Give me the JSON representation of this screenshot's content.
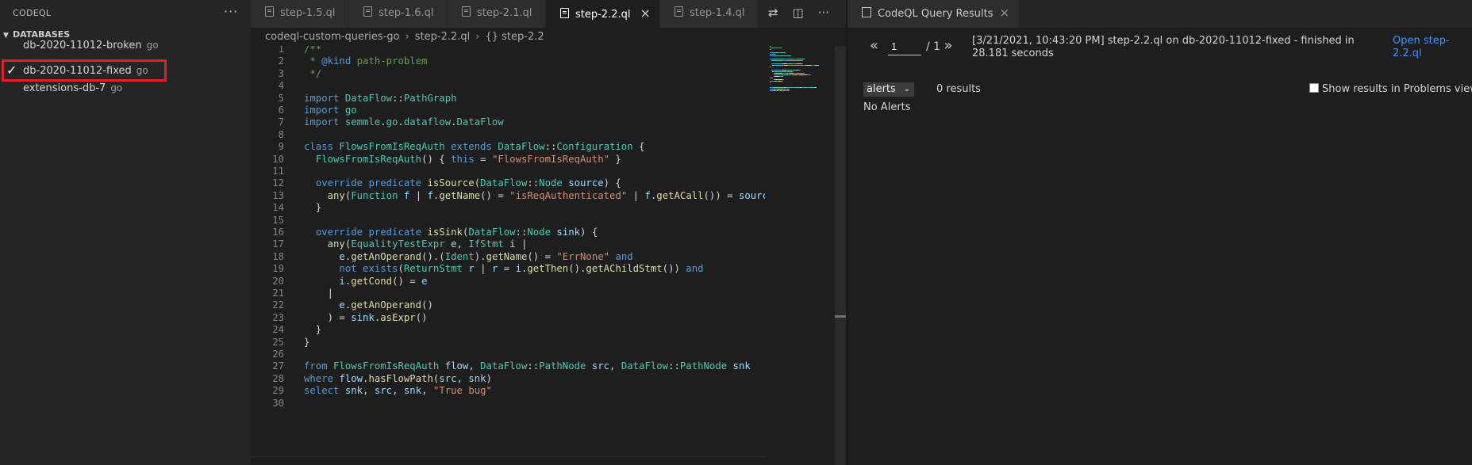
{
  "sidebar": {
    "title": "CODEQL",
    "more": "···",
    "section_label": "DATABASES",
    "items": [
      {
        "name": "db-2020-11012-broken",
        "lang": "go",
        "checked": false
      },
      {
        "name": "db-2020-11012-fixed",
        "lang": "go",
        "checked": true
      },
      {
        "name": "extensions-db-7",
        "lang": "go",
        "checked": false
      }
    ],
    "check_glyph": "✓"
  },
  "tabs": [
    {
      "label": "step-1.5.ql",
      "active": false
    },
    {
      "label": "step-1.6.ql",
      "active": false
    },
    {
      "label": "step-2.1.ql",
      "active": false
    },
    {
      "label": "step-2.2.ql",
      "active": true
    },
    {
      "label": "step-1.4.ql",
      "active": false
    }
  ],
  "tab_close": "×",
  "tab_actions": [
    "compare-changes-icon",
    "split-editor-icon",
    "more-actions-icon"
  ],
  "breadcrumb": [
    "codeql-custom-queries-go",
    "step-2.2.ql",
    "{} step-2.2"
  ],
  "code_lines": [
    [
      [
        "/**",
        "cmt"
      ]
    ],
    [
      [
        " * ",
        "cmt"
      ],
      [
        "@kind",
        "kw"
      ],
      [
        " path-problem",
        "cmt"
      ]
    ],
    [
      [
        " */",
        "cmt"
      ]
    ],
    [],
    [
      [
        "import ",
        "kw"
      ],
      [
        "DataFlow",
        "type"
      ],
      [
        "::",
        "plain"
      ],
      [
        "PathGraph",
        "type"
      ]
    ],
    [
      [
        "import ",
        "kw"
      ],
      [
        "go",
        "type"
      ]
    ],
    [
      [
        "import ",
        "kw"
      ],
      [
        "semmle",
        "type"
      ],
      [
        ".",
        "plain"
      ],
      [
        "go",
        "type"
      ],
      [
        ".",
        "plain"
      ],
      [
        "dataflow",
        "type"
      ],
      [
        ".",
        "plain"
      ],
      [
        "DataFlow",
        "type"
      ]
    ],
    [],
    [
      [
        "class ",
        "kw"
      ],
      [
        "FlowsFromIsReqAuth ",
        "type"
      ],
      [
        "extends ",
        "kw"
      ],
      [
        "DataFlow",
        "type"
      ],
      [
        "::",
        "plain"
      ],
      [
        "Configuration",
        "type"
      ],
      [
        " {",
        "plain"
      ]
    ],
    [
      [
        "  ",
        "plain"
      ],
      [
        "FlowsFromIsReqAuth",
        "type"
      ],
      [
        "() { ",
        "plain"
      ],
      [
        "this",
        "kw"
      ],
      [
        " = ",
        "plain"
      ],
      [
        "\"FlowsFromIsReqAuth\"",
        "str"
      ],
      [
        " }",
        "plain"
      ]
    ],
    [],
    [
      [
        "  ",
        "plain"
      ],
      [
        "override predicate ",
        "kw"
      ],
      [
        "isSource",
        "fn"
      ],
      [
        "(",
        "plain"
      ],
      [
        "DataFlow",
        "type"
      ],
      [
        "::",
        "plain"
      ],
      [
        "Node ",
        "type"
      ],
      [
        "source",
        "var"
      ],
      [
        ") {",
        "plain"
      ]
    ],
    [
      [
        "    ",
        "plain"
      ],
      [
        "any",
        "fn"
      ],
      [
        "(",
        "plain"
      ],
      [
        "Function ",
        "type"
      ],
      [
        "f",
        "var"
      ],
      [
        " | ",
        "plain"
      ],
      [
        "f",
        "var"
      ],
      [
        ".",
        "plain"
      ],
      [
        "getName",
        "fn"
      ],
      [
        "() = ",
        "plain"
      ],
      [
        "\"isReqAuthenticated\"",
        "str"
      ],
      [
        " | ",
        "plain"
      ],
      [
        "f",
        "var"
      ],
      [
        ".",
        "plain"
      ],
      [
        "getACall",
        "fn"
      ],
      [
        "()) = ",
        "plain"
      ],
      [
        "source",
        "var"
      ]
    ],
    [
      [
        "  }",
        "plain"
      ]
    ],
    [],
    [
      [
        "  ",
        "plain"
      ],
      [
        "override predicate ",
        "kw"
      ],
      [
        "isSink",
        "fn"
      ],
      [
        "(",
        "plain"
      ],
      [
        "DataFlow",
        "type"
      ],
      [
        "::",
        "plain"
      ],
      [
        "Node ",
        "type"
      ],
      [
        "sink",
        "var"
      ],
      [
        ") {",
        "plain"
      ]
    ],
    [
      [
        "    ",
        "plain"
      ],
      [
        "any",
        "fn"
      ],
      [
        "(",
        "plain"
      ],
      [
        "EqualityTestExpr ",
        "type"
      ],
      [
        "e",
        "var"
      ],
      [
        ", ",
        "plain"
      ],
      [
        "IfStmt ",
        "type"
      ],
      [
        "i",
        "var"
      ],
      [
        " |",
        "plain"
      ]
    ],
    [
      [
        "      ",
        "plain"
      ],
      [
        "e",
        "var"
      ],
      [
        ".",
        "plain"
      ],
      [
        "getAnOperand",
        "fn"
      ],
      [
        "().(",
        "plain"
      ],
      [
        "Ident",
        "type"
      ],
      [
        ").",
        "plain"
      ],
      [
        "getName",
        "fn"
      ],
      [
        "() = ",
        "plain"
      ],
      [
        "\"ErrNone\"",
        "str"
      ],
      [
        " and",
        "kw"
      ]
    ],
    [
      [
        "      ",
        "plain"
      ],
      [
        "not exists",
        "kw"
      ],
      [
        "(",
        "plain"
      ],
      [
        "ReturnStmt ",
        "type"
      ],
      [
        "r",
        "var"
      ],
      [
        " | ",
        "plain"
      ],
      [
        "r",
        "var"
      ],
      [
        " = ",
        "plain"
      ],
      [
        "i",
        "var"
      ],
      [
        ".",
        "plain"
      ],
      [
        "getThen",
        "fn"
      ],
      [
        "().",
        "plain"
      ],
      [
        "getAChildStmt",
        "fn"
      ],
      [
        "()) ",
        "plain"
      ],
      [
        "and",
        "kw"
      ]
    ],
    [
      [
        "      ",
        "plain"
      ],
      [
        "i",
        "var"
      ],
      [
        ".",
        "plain"
      ],
      [
        "getCond",
        "fn"
      ],
      [
        "() = ",
        "plain"
      ],
      [
        "e",
        "var"
      ]
    ],
    [
      [
        "    |",
        "plain"
      ]
    ],
    [
      [
        "      ",
        "plain"
      ],
      [
        "e",
        "var"
      ],
      [
        ".",
        "plain"
      ],
      [
        "getAnOperand",
        "fn"
      ],
      [
        "()",
        "plain"
      ]
    ],
    [
      [
        "    ) = ",
        "plain"
      ],
      [
        "sink",
        "var"
      ],
      [
        ".",
        "plain"
      ],
      [
        "asExpr",
        "fn"
      ],
      [
        "()",
        "plain"
      ]
    ],
    [
      [
        "  }",
        "plain"
      ]
    ],
    [
      [
        "}",
        "plain"
      ]
    ],
    [],
    [
      [
        "from ",
        "kw"
      ],
      [
        "FlowsFromIsReqAuth ",
        "type"
      ],
      [
        "flow",
        "var"
      ],
      [
        ", ",
        "plain"
      ],
      [
        "DataFlow",
        "type"
      ],
      [
        "::",
        "plain"
      ],
      [
        "PathNode ",
        "type"
      ],
      [
        "src",
        "var"
      ],
      [
        ", ",
        "plain"
      ],
      [
        "DataFlow",
        "type"
      ],
      [
        "::",
        "plain"
      ],
      [
        "PathNode ",
        "type"
      ],
      [
        "snk",
        "var"
      ]
    ],
    [
      [
        "where ",
        "kw"
      ],
      [
        "flow",
        "var"
      ],
      [
        ".",
        "plain"
      ],
      [
        "hasFlowPath",
        "fn"
      ],
      [
        "(",
        "plain"
      ],
      [
        "src",
        "var"
      ],
      [
        ", ",
        "plain"
      ],
      [
        "snk",
        "var"
      ],
      [
        ")",
        "plain"
      ]
    ],
    [
      [
        "select ",
        "kw"
      ],
      [
        "snk",
        "var"
      ],
      [
        ", ",
        "plain"
      ],
      [
        "src",
        "var"
      ],
      [
        ", ",
        "plain"
      ],
      [
        "snk",
        "var"
      ],
      [
        ", ",
        "plain"
      ],
      [
        "\"True bug\"",
        "str"
      ]
    ],
    []
  ],
  "results": {
    "tab_label": "CodeQL Query Results",
    "tab_close": "×",
    "prev": "«",
    "next": "»",
    "page_value": "1",
    "page_total": "/ 1",
    "info": "[3/21/2021, 10:43:20 PM] step-2.2.ql on db-2020-11012-fixed - finished in 28.181 seconds",
    "open_link": "Open step-2.2.ql",
    "select_value": "alerts",
    "caret": "⌄",
    "count": "0 results",
    "problems_label": "Show results in Problems view",
    "no_alerts": "No Alerts"
  },
  "colors": {
    "highlight_box": "#e51f26",
    "link": "#3794ff",
    "keyword": "#569cd6",
    "type": "#4ec9b0",
    "function": "#dcdcaa",
    "string": "#ce9178",
    "comment": "#6a9955",
    "variable": "#9cdcfe"
  }
}
